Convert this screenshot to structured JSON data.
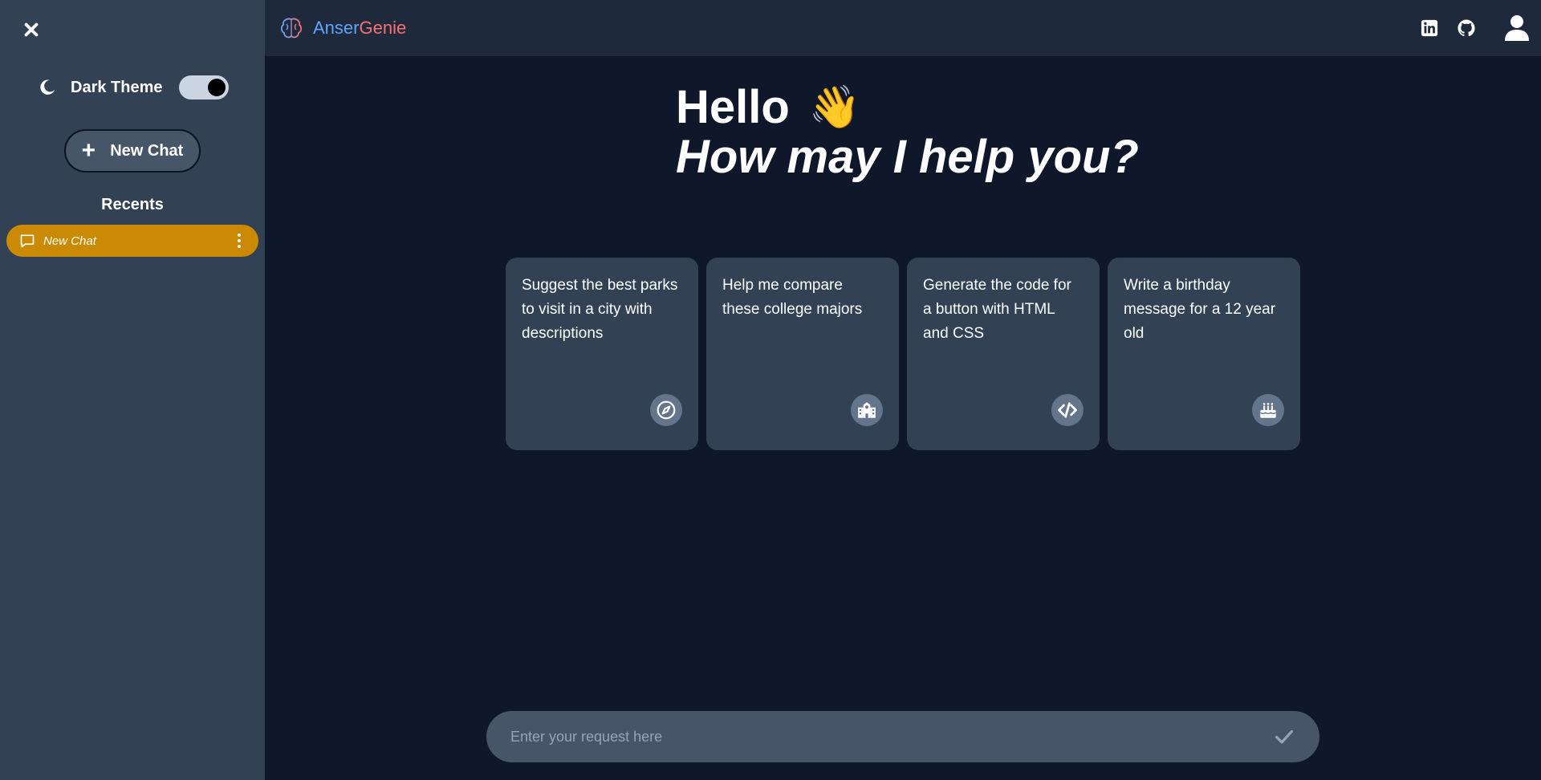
{
  "sidebar": {
    "theme_label": "Dark Theme",
    "theme_enabled": true,
    "new_chat_label": "New Chat",
    "recents_heading": "Recents",
    "recents": [
      {
        "label": "New Chat"
      }
    ]
  },
  "header": {
    "brand_part1": "Anser",
    "brand_part2": "Genie",
    "icons": [
      "linkedin-icon",
      "github-icon",
      "user-icon"
    ]
  },
  "greeting": {
    "hello": "Hello",
    "emoji": "👋",
    "subtitle": "How may I help you?"
  },
  "cards": [
    {
      "text": "Suggest the best parks to visit in a city with descriptions",
      "icon": "compass-icon"
    },
    {
      "text": "Help me compare these college majors",
      "icon": "school-icon"
    },
    {
      "text": "Generate the code for a button with HTML and CSS",
      "icon": "code-icon"
    },
    {
      "text": "Write a birthday message for a 12 year old",
      "icon": "cake-icon"
    }
  ],
  "input": {
    "placeholder": "Enter your request here",
    "value": ""
  },
  "colors": {
    "background": "#0f172a",
    "sidebar": "#334155",
    "header": "#1e293b",
    "accent": "#ca8a04",
    "brand_blue": "#60a5fa",
    "brand_red": "#f87171"
  }
}
